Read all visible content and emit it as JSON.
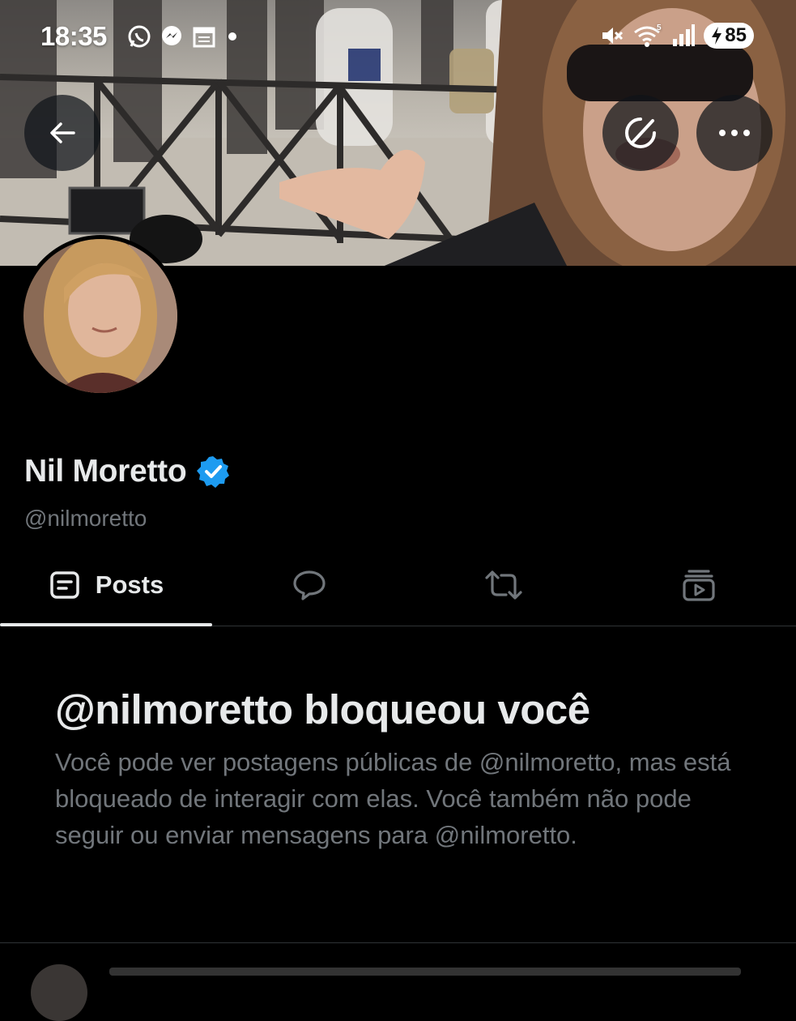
{
  "status_bar": {
    "time": "18:35",
    "battery": "85",
    "notification_icons": [
      "whatsapp-icon",
      "messenger-icon",
      "calendar-icon",
      "dot-icon"
    ],
    "system_icons": [
      "mute-icon",
      "wifi-icon",
      "signal-icon",
      "battery-icon"
    ]
  },
  "header": {
    "back_icon": "arrow-left-icon",
    "grok_icon": "grok-icon",
    "more_icon": "more-horizontal-icon"
  },
  "profile": {
    "display_name": "Nil Moretto",
    "handle": "@nilmoretto",
    "verified": true,
    "verified_color": "#1d9bf0"
  },
  "tabs": [
    {
      "label": "Posts",
      "icon": "posts-icon",
      "active": true
    },
    {
      "label": "",
      "icon": "reply-bubble-icon",
      "active": false
    },
    {
      "label": "",
      "icon": "repost-icon",
      "active": false
    },
    {
      "label": "",
      "icon": "media-icon",
      "active": false
    }
  ],
  "blocked": {
    "title": "@nilmoretto bloqueou você",
    "description": "Você pode ver postagens públicas de @nilmoretto, mas está bloqueado de interagir com elas. Você também não pode seguir ou enviar mensagens para @nilmoretto."
  },
  "colors": {
    "background": "#000000",
    "text_primary": "#e7e9ea",
    "text_secondary": "#71767b",
    "divider": "#2f3336",
    "accent": "#1d9bf0"
  }
}
